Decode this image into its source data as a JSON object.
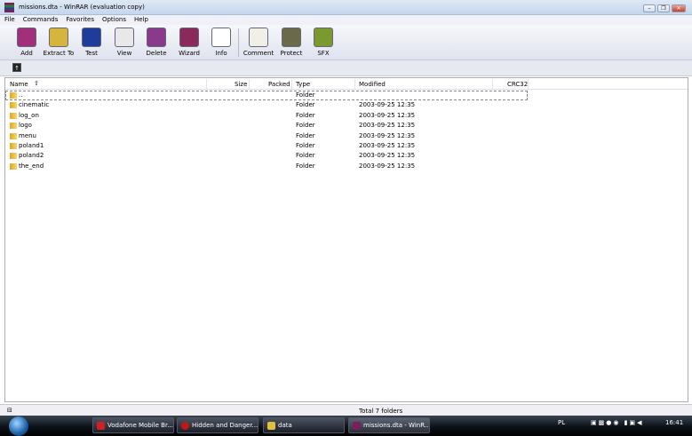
{
  "window": {
    "title": "missions.dta - WinRAR (evaluation copy)",
    "minimize": "–",
    "restore": "❐",
    "close": "✕"
  },
  "menu": [
    "File",
    "Commands",
    "Favorites",
    "Options",
    "Help"
  ],
  "toolbar": [
    {
      "label": "Add",
      "icon": "add-archive-icon",
      "color": "#a0307a"
    },
    {
      "label": "Extract To",
      "icon": "extract-icon",
      "color": "#d6b440"
    },
    {
      "label": "Test",
      "icon": "test-icon",
      "color": "#1f3c9a"
    },
    {
      "label": "View",
      "icon": "view-icon",
      "color": "#e8e8e8"
    },
    {
      "label": "Delete",
      "icon": "delete-icon",
      "color": "#8a3a8a"
    },
    {
      "label": "Wizard",
      "icon": "wizard-icon",
      "color": "#8a2a5a"
    },
    {
      "label": "Info",
      "icon": "info-icon",
      "color": "#ffffff"
    },
    {
      "label": "Comment",
      "icon": "comment-icon",
      "color": "#f0f0e8"
    },
    {
      "label": "Protect",
      "icon": "protect-icon",
      "color": "#6a6a4a"
    },
    {
      "label": "SFX",
      "icon": "sfx-icon",
      "color": "#7a9a30"
    }
  ],
  "columns": {
    "name": "Name",
    "size": "Size",
    "packed": "Packed",
    "type": "Type",
    "modified": "Modified",
    "crc": "CRC32"
  },
  "rows": [
    {
      "name": "..",
      "type": "Folder",
      "modified": ""
    },
    {
      "name": "cinematic",
      "type": "Folder",
      "modified": "2003-09-25 12:35"
    },
    {
      "name": "log_on",
      "type": "Folder",
      "modified": "2003-09-25 12:35"
    },
    {
      "name": "logo",
      "type": "Folder",
      "modified": "2003-09-25 12:35"
    },
    {
      "name": "menu",
      "type": "Folder",
      "modified": "2003-09-25 12:35"
    },
    {
      "name": "poland1",
      "type": "Folder",
      "modified": "2003-09-25 12:35"
    },
    {
      "name": "poland2",
      "type": "Folder",
      "modified": "2003-09-25 12:35"
    },
    {
      "name": "the_end",
      "type": "Folder",
      "modified": "2003-09-25 12:35"
    }
  ],
  "status": {
    "text": "Total 7 folders"
  },
  "taskbar": {
    "tasks": [
      {
        "label": "Vodafone Mobile Br...",
        "color": "#d02020"
      },
      {
        "label": "Hidden and Danger...",
        "color": "#c01818"
      },
      {
        "label": "data",
        "color": "#e0c040"
      },
      {
        "label": "missions.dta - WinR...",
        "color": "#7a1f5c"
      }
    ],
    "lang": "PL",
    "clock": "16:41"
  }
}
